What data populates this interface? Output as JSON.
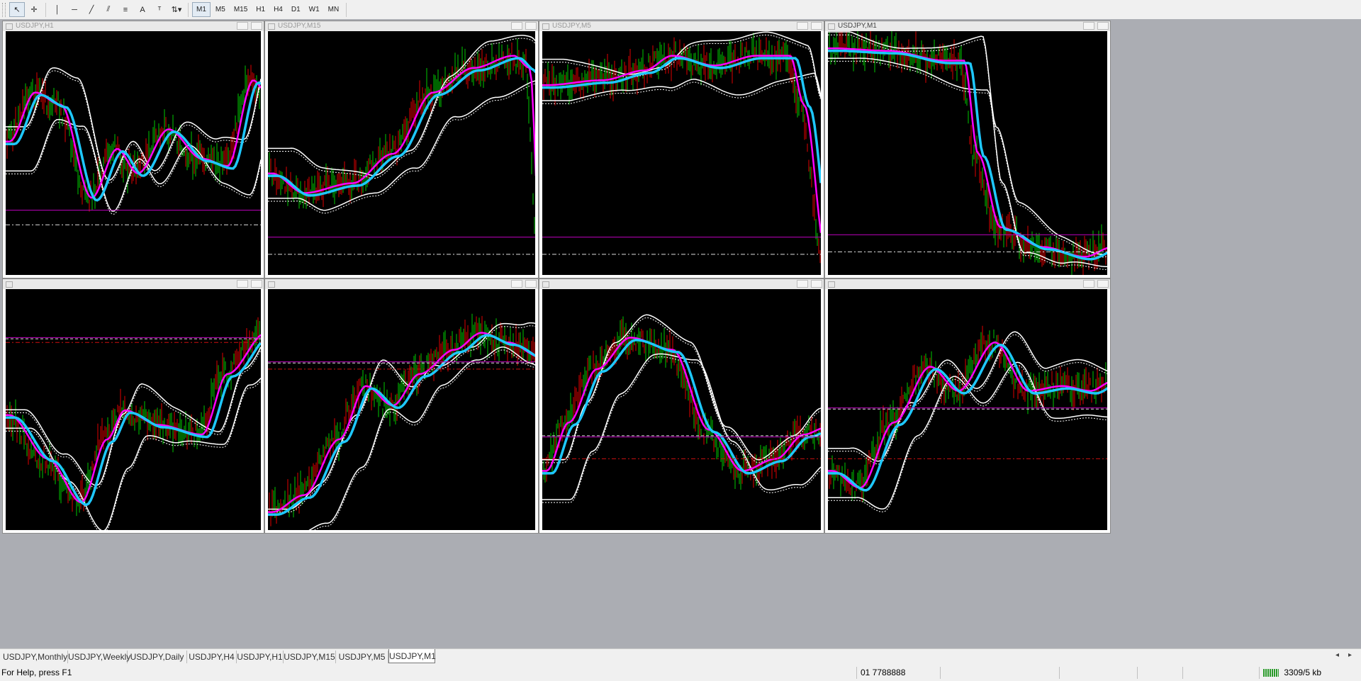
{
  "toolbar": {
    "tools": [
      {
        "name": "cursor-icon",
        "glyph": "↖"
      },
      {
        "name": "crosshair-icon",
        "glyph": "✛"
      },
      {
        "name": "sep"
      },
      {
        "name": "vertical-line-icon",
        "glyph": "│"
      },
      {
        "name": "horizontal-line-icon",
        "glyph": "─"
      },
      {
        "name": "trendline-icon",
        "glyph": "╱"
      },
      {
        "name": "equidistant-channel-icon",
        "glyph": "⫽"
      },
      {
        "name": "fibonacci-icon",
        "glyph": "≡"
      },
      {
        "name": "text-icon",
        "glyph": "A"
      },
      {
        "name": "text-label-icon",
        "glyph": "ᵀ"
      },
      {
        "name": "arrows-dropdown-icon",
        "glyph": "⇅▾"
      },
      {
        "name": "sep"
      }
    ],
    "timeframes": [
      "M1",
      "M5",
      "M15",
      "H1",
      "H4",
      "D1",
      "W1",
      "MN"
    ],
    "active_timeframe": "M1"
  },
  "windows": [
    {
      "title": "USDJPY,H1",
      "active": false
    },
    {
      "title": "USDJPY,M15",
      "active": false
    },
    {
      "title": "USDJPY,M5",
      "active": false
    },
    {
      "title": "USDJPY,M1",
      "active": true
    },
    {
      "title": "",
      "active": false
    },
    {
      "title": "",
      "active": false
    },
    {
      "title": "",
      "active": false
    },
    {
      "title": "",
      "active": false
    }
  ],
  "tabs": [
    "USDJPY,Monthly",
    "USDJPY,Weekly",
    "USDJPY,Daily",
    "USDJPY,H4",
    "USDJPY,H1",
    "USDJPY,M15",
    "USDJPY,M5",
    "USDJPY,M1"
  ],
  "active_tab": "USDJPY,M1",
  "tab_arrows": {
    "left": "◂",
    "right": "▸"
  },
  "status": {
    "help": "For Help, press F1",
    "profile": "01 7788888",
    "traffic": "3309/5 kb"
  },
  "colors": {
    "chart_bg": "#000000",
    "up_bar": "#00c800",
    "down_bar": "#e00000",
    "ma_fast": "#ff00ff",
    "ma_slow": "#1ec8ff",
    "envelope": "#ffffff",
    "level_magenta": "#c000c0",
    "level_red": "#cc1111",
    "level_white": "#dddddd"
  }
}
